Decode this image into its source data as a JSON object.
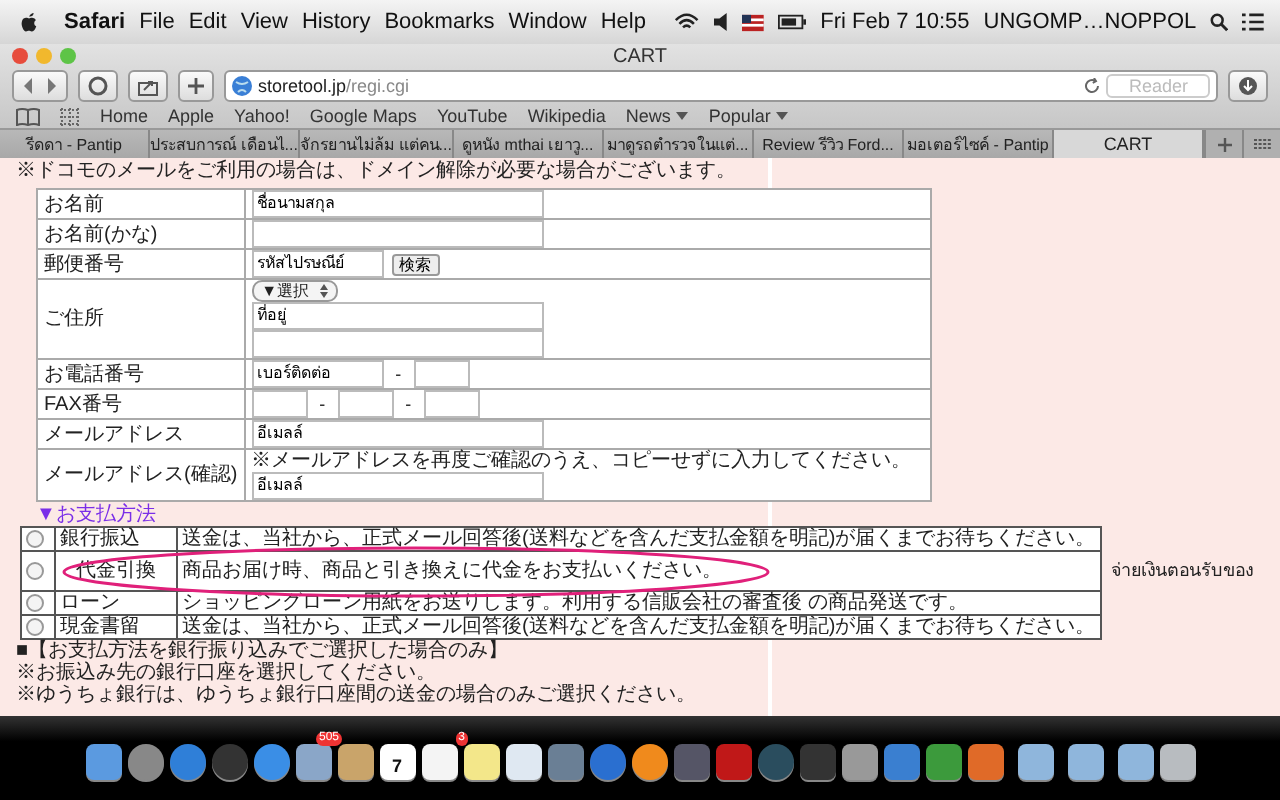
{
  "menubar": {
    "app": "Safari",
    "items": [
      "File",
      "Edit",
      "View",
      "History",
      "Bookmarks",
      "Window",
      "Help"
    ],
    "clock": "Fri Feb 7  10:55",
    "user": "UNGOMP…NOPPOL"
  },
  "window": {
    "title": "CART"
  },
  "toolbar": {
    "url_host": "storetool.jp",
    "url_path": "/regi.cgi",
    "reader": "Reader"
  },
  "bookmarks": [
    {
      "label": "Home",
      "menu": false
    },
    {
      "label": "Apple",
      "menu": false
    },
    {
      "label": "Yahoo!",
      "menu": false
    },
    {
      "label": "Google Maps",
      "menu": false
    },
    {
      "label": "YouTube",
      "menu": false
    },
    {
      "label": "Wikipedia",
      "menu": false
    },
    {
      "label": "News",
      "menu": true
    },
    {
      "label": "Popular",
      "menu": true
    }
  ],
  "tabs": [
    {
      "label": "รีดดา - Pantip",
      "selected": false
    },
    {
      "label": "ประสบการณ์ เดือนไ...",
      "selected": false
    },
    {
      "label": "จักรยานไม่ล้ม แต่คน...",
      "selected": false
    },
    {
      "label": "ดูหนัง mthai เยาวู...",
      "selected": false
    },
    {
      "label": "มาดูรถตำรวจในแต่...",
      "selected": false
    },
    {
      "label": "Review รีวิว Ford...",
      "selected": false
    },
    {
      "label": "มอเตอร์ไซค์ - Pantip",
      "selected": false
    },
    {
      "label": "CART",
      "selected": true
    }
  ],
  "intro": "※ドコモのメールをご利用の場合は、ドメイン解除が必要な場合がございます。",
  "form": [
    {
      "label": "お名前",
      "kind": "text",
      "value": "ชื่อนามสกุล"
    },
    {
      "label": "お名前(かな)",
      "kind": "text"
    },
    {
      "label": "郵便番号",
      "kind": "zip",
      "value": "รหัสไปรษณีย์",
      "button": "検索"
    },
    {
      "label": "ご住所",
      "kind": "address",
      "select": "▼選択",
      "value": "ที่อยู่"
    },
    {
      "label": "お電話番号",
      "kind": "phone",
      "value": "เบอร์ติดต่อ",
      "dashes": [
        "-"
      ]
    },
    {
      "label": "FAX番号",
      "kind": "phone",
      "dashes": [
        "-",
        "-"
      ]
    },
    {
      "label": "メールアドレス",
      "kind": "text",
      "value": "อีเมลล์"
    },
    {
      "label": "メールアドレス(確認)",
      "kind": "confirm",
      "note": "※メールアドレスを再度ご確認のうえ、コピーせずに入力してください。",
      "value": "อีเมลล์"
    }
  ],
  "payment_heading": "▼お支払方法",
  "payment": [
    {
      "label": "銀行振込",
      "selected": false,
      "desc": "送金は、当社から、正式メール回答後(送料などを含んだ支払金額を明記)が届くまでお待ちください。",
      "circled": false
    },
    {
      "label": "代金引換",
      "selected": false,
      "desc": "商品お届け時、商品と引き換えに代金をお支払いください。",
      "circled": true
    },
    {
      "label": "ローン",
      "selected": false,
      "desc": "ショッピングローン用紙をお送りします。利用する信販会社の審査後 の商品発送です。",
      "circled": false
    },
    {
      "label": "現金書留",
      "selected": false,
      "desc": "送金は、当社から、正式メール回答後(送料などを含んだ支払金額を明記)が届くまでお待ちください。",
      "circled": false
    }
  ],
  "annotation": "จ่ายเงินตอนรับของ",
  "notes": [
    "■【お支払方法を銀行振り込みでご選択した場合のみ】",
    "※お振込み先の銀行口座を選択してください。",
    "※ゆうちょ銀行は、ゆうちょ銀行口座間の送金の場合のみご選択ください。"
  ],
  "dock": [
    {
      "kind": "finder"
    },
    {
      "kind": "rocket"
    },
    {
      "kind": "appstore"
    },
    {
      "kind": "dashboard"
    },
    {
      "kind": "safari"
    },
    {
      "kind": "mail",
      "badge": "505"
    },
    {
      "kind": "contacts"
    },
    {
      "kind": "calendar",
      "text": "7"
    },
    {
      "kind": "reminders",
      "badge": "3"
    },
    {
      "kind": "notes"
    },
    {
      "kind": "preview"
    },
    {
      "kind": "photos"
    },
    {
      "kind": "itunes"
    },
    {
      "kind": "ibooks"
    },
    {
      "kind": "iphoto"
    },
    {
      "kind": "photobooth"
    },
    {
      "kind": "timemachine"
    },
    {
      "kind": "imovie"
    },
    {
      "kind": "prefs"
    },
    {
      "kind": "word"
    },
    {
      "kind": "excel"
    },
    {
      "kind": "powerpoint"
    },
    {
      "kind": "folder"
    },
    {
      "kind": "folder"
    },
    {
      "kind": "folder"
    },
    {
      "kind": "trash"
    }
  ]
}
